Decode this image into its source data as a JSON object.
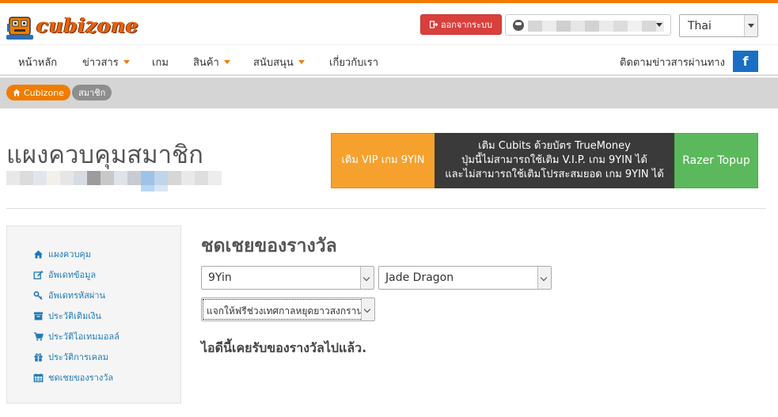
{
  "header": {
    "logo_text": "cubizone",
    "logout_label": "ออกจากระบบ",
    "language": "Thai",
    "colors": {
      "accent": "#f07c00",
      "logout": "#d9403c",
      "facebook": "#1a6fc4"
    }
  },
  "nav": {
    "items": [
      {
        "label": "หน้าหลัก",
        "has_dropdown": false
      },
      {
        "label": "ข่าวสาร",
        "has_dropdown": true
      },
      {
        "label": "เกม",
        "has_dropdown": false
      },
      {
        "label": "สินค้า",
        "has_dropdown": true
      },
      {
        "label": "สนับสนุน",
        "has_dropdown": true
      },
      {
        "label": "เกี่ยวกับเรา",
        "has_dropdown": false
      }
    ],
    "follow_text": "ติดตามข่าวสารผ่านทาง",
    "facebook_icon": "f"
  },
  "breadcrumb": {
    "home": "Cubizone",
    "current": "สมาชิก"
  },
  "page": {
    "title": "แผงควบคุมสมาชิก"
  },
  "banners": {
    "vip": "เติม VIP เกม 9YIN",
    "truemoney_line1": "เติม Cubits ด้วยบัตร TrueMoney",
    "truemoney_line2": "ปุ่มนี้ไม่สามารถใช้เติม V.I.P. เกม 9YIN ได้",
    "truemoney_line3": "และไม่สามารถใช้เติมโปรสะสมยอด เกม 9YIN ได้",
    "razer": "Razer Topup"
  },
  "sidebar": {
    "items": [
      {
        "label": "แผงควบคุม",
        "icon": "home-icon"
      },
      {
        "label": "อัพเดทข้อมูล",
        "icon": "edit-icon"
      },
      {
        "label": "อัพเดทรหัสผ่าน",
        "icon": "key-icon"
      },
      {
        "label": "ประวัติเติมเงิน",
        "icon": "archive-icon"
      },
      {
        "label": "ประวัติไอเทมมอลล์",
        "icon": "cart-icon"
      },
      {
        "label": "ประวัติการเคลม",
        "icon": "gift-icon"
      },
      {
        "label": "ชดเชยของรางวัล",
        "icon": "calendar-icon"
      }
    ]
  },
  "reward": {
    "title": "ชดเชยของรางวัล",
    "game_select": "9Yin",
    "server_select": "Jade Dragon",
    "event_select": "แจกให้ฟรีช่วงเทศกาลหยุดยาวสงกรานต์",
    "message": "ไอดีนี้เคยรับของรางวัลไปแล้ว."
  }
}
